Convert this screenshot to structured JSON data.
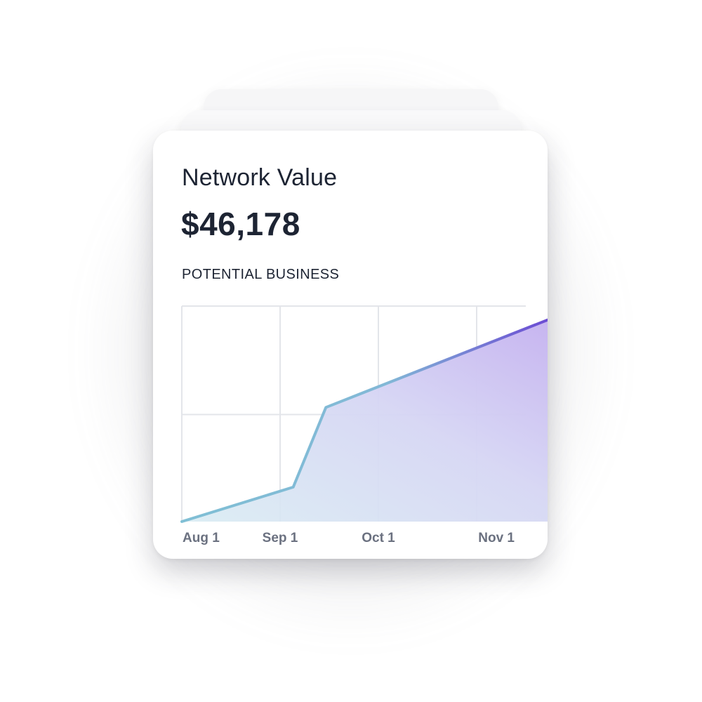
{
  "card": {
    "title": "Network Value",
    "value": "$46,178",
    "section_label": "POTENTIAL BUSINESS"
  },
  "chart_data": {
    "type": "area",
    "title": "POTENTIAL BUSINESS",
    "xlabel": "",
    "ylabel": "",
    "x_tick_labels": [
      "Aug 1",
      "Sep 1",
      "Oct 1",
      "Nov 1"
    ],
    "x": [
      "Aug 1",
      "Sep 5",
      "Sep 15",
      "Nov 25"
    ],
    "values": [
      0,
      16,
      53,
      95
    ],
    "ylim": [
      0,
      100
    ],
    "grid": true,
    "legend": "none",
    "colors": {
      "line_start": "#7ec0d6",
      "line_end": "#6a4bd6",
      "fill_start": "#cfe6f0",
      "fill_end": "#c9b8f2",
      "grid": "#e3e5ea"
    }
  }
}
